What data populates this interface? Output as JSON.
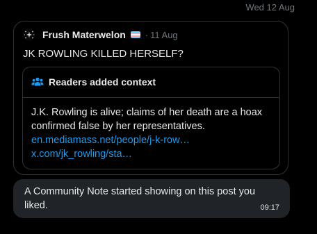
{
  "header": {
    "date": "Wed 12 Aug"
  },
  "tweet": {
    "author": "Frush Materwelon",
    "separator": "·",
    "date": "11 Aug",
    "text": "JK ROWLING KILLED HERSELF?",
    "avatar_icon": "sparkle-avatar-icon",
    "flag_icon": "trans-flag-icon",
    "flag_colors": [
      "#5bcefa",
      "#f5a9b8",
      "#ffffff",
      "#f5a9b8",
      "#5bcefa"
    ]
  },
  "community_note": {
    "title": "Readers added context",
    "icon": "people-icon",
    "body": "J.K. Rowling is alive; claims of her death are a hoax confirmed false by her representatives.",
    "links": [
      "en.mediamass.net/people/j-k-row…",
      "x.com/jk_rowling/sta…"
    ]
  },
  "notification": {
    "text": "A Community Note started showing on this post you liked.",
    "time": "09:17"
  },
  "colors": {
    "background": "#000000",
    "text": "#e7e9ea",
    "muted": "#71767b",
    "link": "#1d9bf0",
    "border": "#2f3336",
    "bubble": "#202327"
  }
}
